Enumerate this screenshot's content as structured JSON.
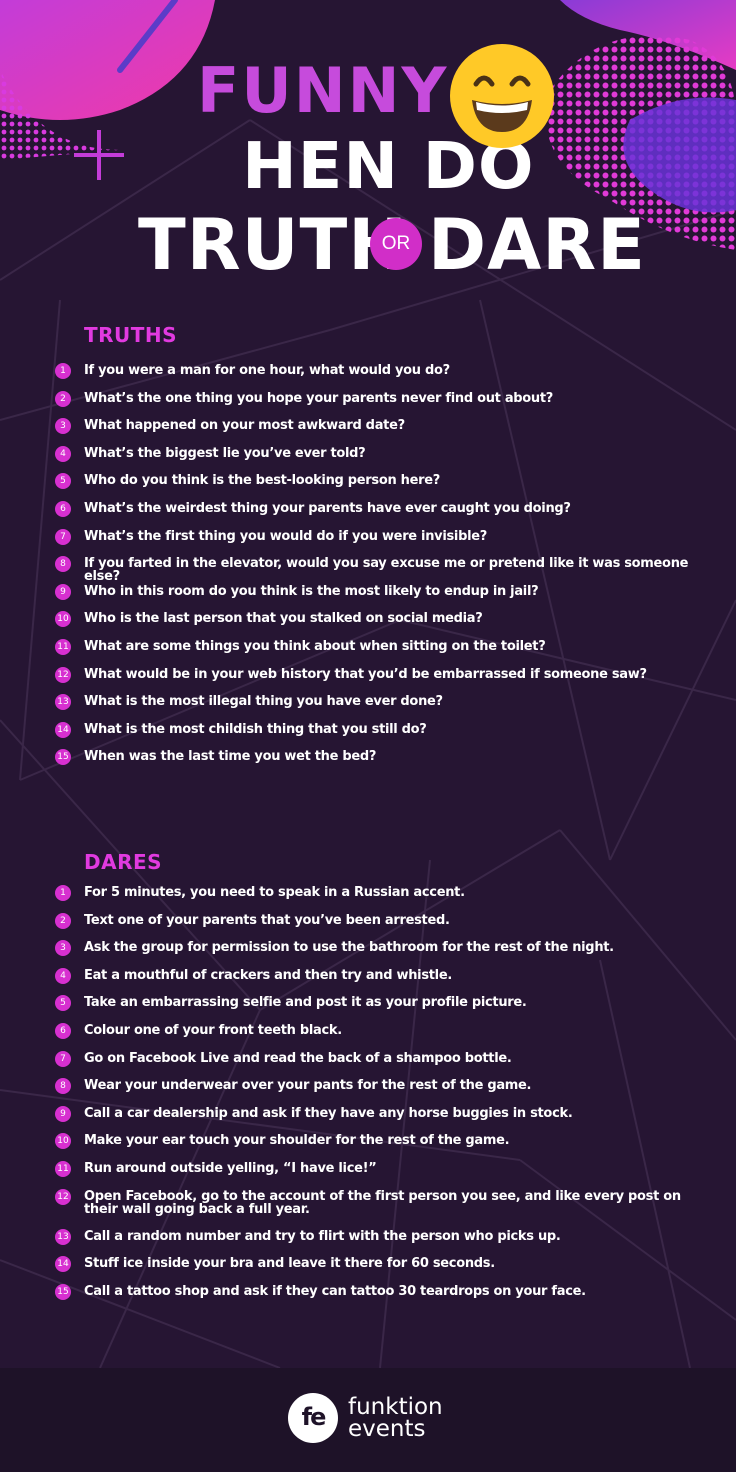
{
  "header": {
    "title_line1": "FUNNY",
    "title_line2": "HEN DO",
    "title_truth": "TRUTH",
    "title_or": "OR",
    "title_dare": "DARE"
  },
  "truths": {
    "heading": "TRUTHS",
    "items": [
      {
        "n": "1",
        "text": "If you were a man for one hour, what would you do?"
      },
      {
        "n": "2",
        "text": "What’s the one thing you hope your parents never find out about?"
      },
      {
        "n": "3",
        "text": "What happened on your most awkward date?"
      },
      {
        "n": "4",
        "text": "What’s the biggest lie you’ve ever told?"
      },
      {
        "n": "5",
        "text": "Who do you think is the best-looking person here?"
      },
      {
        "n": "6",
        "text": "What’s the weirdest thing your parents have ever caught you doing?"
      },
      {
        "n": "7",
        "text": "What’s the first thing you would do if you were invisible?"
      },
      {
        "n": "8",
        "text": "If you farted in the elevator, would you say excuse me or pretend like it was someone else?"
      },
      {
        "n": "9",
        "text": "Who in this room do you think is the most likely to endup in jail?"
      },
      {
        "n": "10",
        "text": "Who is the last person that you stalked on social media?"
      },
      {
        "n": "11",
        "text": "What are some things you think about when sitting on the toilet?"
      },
      {
        "n": "12",
        "text": "What would be in your web history that you’d be embarrassed if someone saw?"
      },
      {
        "n": "13",
        "text": "What is the most illegal thing you have ever done?"
      },
      {
        "n": "14",
        "text": "What is the most childish thing that you still do?"
      },
      {
        "n": "15",
        "text": "When was the last time you wet the bed?"
      }
    ]
  },
  "dares": {
    "heading": "DARES",
    "items": [
      {
        "n": "1",
        "text": "For 5 minutes, you need to speak in a Russian accent."
      },
      {
        "n": "2",
        "text": "Text one of your parents that you’ve been arrested."
      },
      {
        "n": "3",
        "text": "Ask the group for permission to use the bathroom for the rest of the night."
      },
      {
        "n": "4",
        "text": "Eat a mouthful of crackers and then try and whistle."
      },
      {
        "n": "5",
        "text": "Take an embarrassing selfie and post it as your profile picture."
      },
      {
        "n": "6",
        "text": "Colour one of your front teeth black."
      },
      {
        "n": "7",
        "text": "Go on Facebook Live and read the back of a shampoo bottle."
      },
      {
        "n": "8",
        "text": "Wear your underwear over your pants for the rest of the game."
      },
      {
        "n": "9",
        "text": "Call a car dealership and ask if they have any horse buggies in stock."
      },
      {
        "n": "10",
        "text": "Make your ear touch your shoulder for the rest of the game."
      },
      {
        "n": "11",
        "text": "Run around outside yelling, “I have lice!”"
      },
      {
        "n": "12",
        "text": "Open Facebook, go to the account of the first person you see, and like every post on their wall going back a full year."
      },
      {
        "n": "13",
        "text": "Call a random number and try to flirt with the person who picks up."
      },
      {
        "n": "14",
        "text": "Stuff ice inside your bra and leave it there for 60 seconds."
      },
      {
        "n": "15",
        "text": "Call a tattoo shop and ask if they can tattoo 30 teardrops on your face."
      }
    ]
  },
  "footer": {
    "logo_mark": "fe",
    "brand_line1": "funktion",
    "brand_line2": "events"
  },
  "colors": {
    "background": "#261533",
    "accent": "#d730d0",
    "heading": "#e13ae0",
    "title_funny": "#c64bdc"
  }
}
